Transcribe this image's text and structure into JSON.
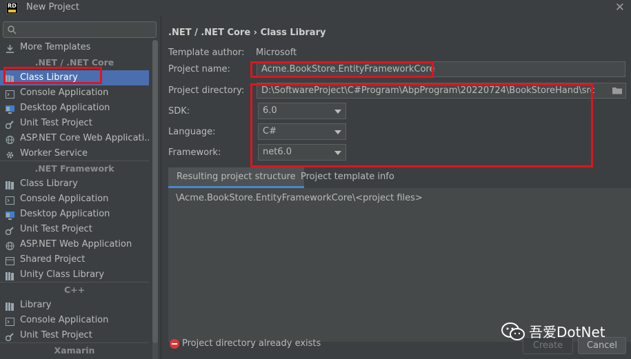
{
  "window": {
    "title": "New Project"
  },
  "search": {
    "placeholder": ""
  },
  "sidebar": {
    "more_templates": "More Templates",
    "sections": [
      {
        "header": ".NET / .NET Core"
      },
      {
        "header": ".NET Framework"
      },
      {
        "header": "C++"
      },
      {
        "header": "Xamarin"
      }
    ],
    "dotnet_core": [
      "Class Library",
      "Console Application",
      "Desktop Application",
      "Unit Test Project",
      "ASP.NET Core Web Applicati...",
      "Worker Service"
    ],
    "dotnet_framework": [
      "Class Library",
      "Console Application",
      "Desktop Application",
      "Unit Test Project",
      "ASP.NET Web Application",
      "Shared Project",
      "Unity Class Library"
    ],
    "cpp": [
      "Library",
      "Console Application",
      "Unit Test Project"
    ],
    "xamarin": [
      "Library"
    ],
    "selected": "Class Library"
  },
  "main": {
    "breadcrumb": ".NET / .NET Core › Class Library",
    "template_author_label": "Template author:",
    "template_author_value": "Microsoft",
    "project_name_label": "Project name:",
    "project_name_value": "Acme.BookStore.EntityFrameworkCore",
    "project_directory_label": "Project directory:",
    "project_directory_value": "D:\\SoftwareProject\\C#Program\\AbpProgram\\20220724\\BookStoreHand\\src",
    "sdk_label": "SDK:",
    "sdk_value": "6.0",
    "language_label": "Language:",
    "language_value": "C#",
    "framework_label": "Framework:",
    "framework_value": "net6.0",
    "tabs": [
      {
        "label": "Resulting project structure",
        "active": true
      },
      {
        "label": "Project template info",
        "active": false
      }
    ],
    "structure_text": "\\Acme.BookStore.EntityFrameworkCore\\<project files>",
    "error_text": "Project directory already exists"
  },
  "buttons": {
    "create": "Create",
    "cancel": "Cancel"
  },
  "watermark": {
    "text": "吾爱DotNet"
  },
  "colors": {
    "selection": "#4b6eaf",
    "annotation": "#e0141e",
    "error": "#d9373b",
    "tab_underline": "#4a88c7"
  }
}
